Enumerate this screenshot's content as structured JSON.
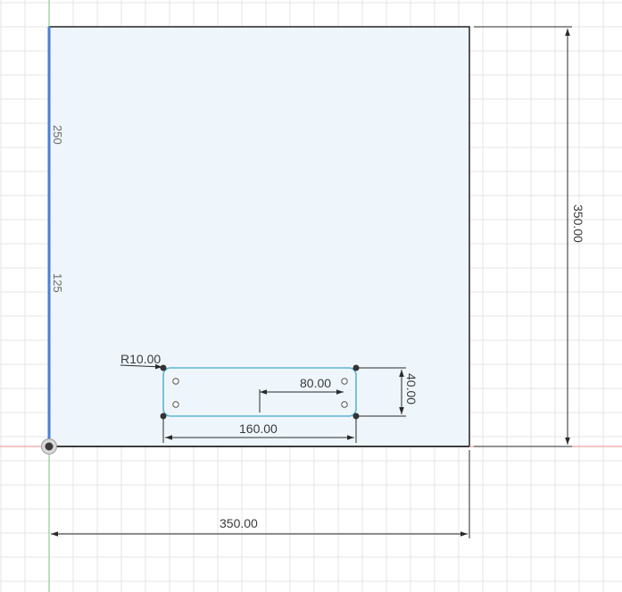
{
  "sketch": {
    "dimensions": {
      "radius": "R10.00",
      "offset": "80.00",
      "slot_height": "40.00",
      "slot_width": "160.00",
      "overall_width": "350.00",
      "overall_height": "350.00"
    },
    "axis_ticks": {
      "upper": "250",
      "lower": "125"
    },
    "colors": {
      "grid": "#e6e6e6",
      "profile_fill": "#eef6fc",
      "profile_edge": "#222222",
      "selected_edge": "#4a7fd4",
      "slot_edge": "#5bb6d6",
      "x_axis": "#e88a8a",
      "y_axis": "#76c776",
      "dimension": "#2a2a2a"
    }
  }
}
